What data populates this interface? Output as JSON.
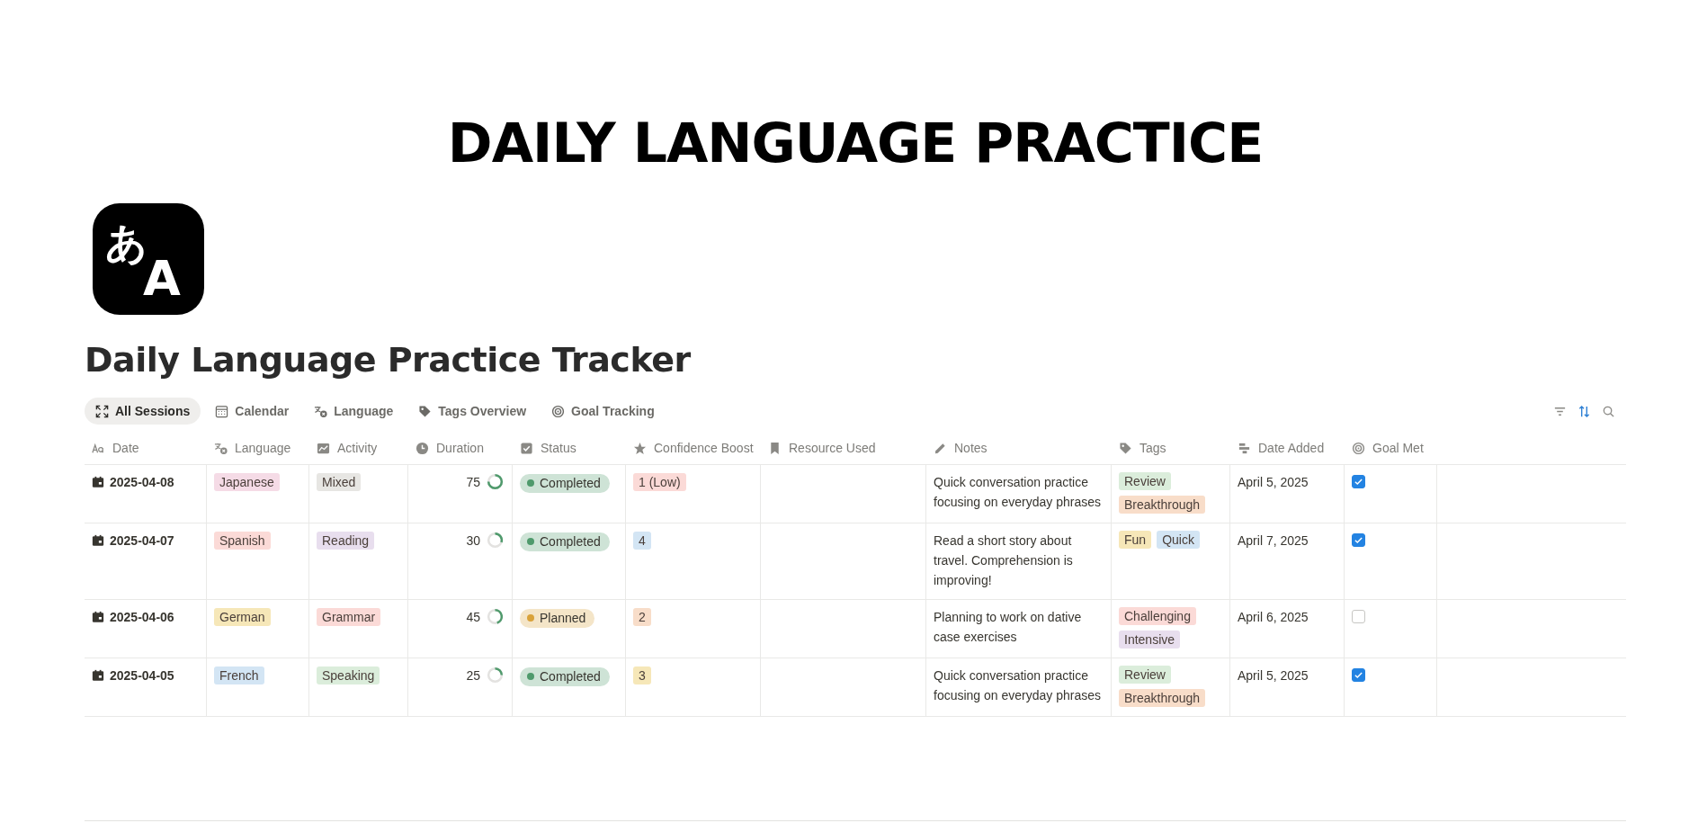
{
  "banner": {
    "title": "DAILY LANGUAGE PRACTICE"
  },
  "page_icon": {
    "glyphs": [
      "あ",
      "A"
    ]
  },
  "page_title": "Daily Language Practice Tracker",
  "views": [
    {
      "label": "All Sessions",
      "selected": true
    },
    {
      "label": "Calendar",
      "selected": false
    },
    {
      "label": "Language",
      "selected": false
    },
    {
      "label": "Tags Overview",
      "selected": false
    },
    {
      "label": "Goal Tracking",
      "selected": false
    }
  ],
  "toolbar": [
    {
      "kind": "filter",
      "active": false
    },
    {
      "kind": "sort",
      "active": true
    },
    {
      "kind": "search",
      "active": false
    }
  ],
  "table": {
    "columns": [
      "Date",
      "Language",
      "Activity",
      "Duration",
      "Status",
      "Confidence Boost",
      "Resource Used",
      "Notes",
      "Tags",
      "Date Added",
      "Goal Met"
    ],
    "rows": [
      {
        "date": "2025-04-08",
        "language": {
          "label": "Japanese",
          "color": "#f5dbe6"
        },
        "activity": {
          "label": "Mixed",
          "color": "#e7e6e3"
        },
        "duration": "75",
        "status": {
          "label": "Completed",
          "color": "#4f9a6c"
        },
        "confidence": {
          "label": "1 (Low)",
          "color": "#fbdad7"
        },
        "notes": "Quick conversation practice focusing on everyday phrases",
        "tags": [
          {
            "label": "Review",
            "color": "#dbeddb"
          },
          {
            "label": "Breakthrough",
            "color": "#f8ddc9"
          }
        ],
        "date_added": "April 5, 2025",
        "goal_met": true
      },
      {
        "date": "2025-04-07",
        "language": {
          "label": "Spanish",
          "color": "#fbdad7"
        },
        "activity": {
          "label": "Reading",
          "color": "#e8deee"
        },
        "duration": "30",
        "status": {
          "label": "Completed",
          "color": "#4f9a6c"
        },
        "confidence": {
          "label": "4",
          "color": "#d3e5f4"
        },
        "notes": "Read a short story about travel. Comprehension is improving!",
        "tags": [
          {
            "label": "Fun",
            "color": "#f6e7b8"
          },
          {
            "label": "Quick",
            "color": "#d3e5f4"
          }
        ],
        "date_added": "April 7, 2025",
        "goal_met": true
      },
      {
        "date": "2025-04-06",
        "language": {
          "label": "German",
          "color": "#f6e7b8"
        },
        "activity": {
          "label": "Grammar",
          "color": "#fbdad7"
        },
        "duration": "45",
        "status": {
          "label": "Planned",
          "color": "#d9a23a"
        },
        "confidence": {
          "label": "2",
          "color": "#f8ddc9"
        },
        "notes": "Planning to work on dative case exercises",
        "tags": [
          {
            "label": "Challenging",
            "color": "#fbdad7"
          },
          {
            "label": "Intensive",
            "color": "#e8deee"
          }
        ],
        "date_added": "April 6, 2025",
        "goal_met": false
      },
      {
        "date": "2025-04-05",
        "language": {
          "label": "French",
          "color": "#d3e5f4"
        },
        "activity": {
          "label": "Speaking",
          "color": "#dbeddb"
        },
        "duration": "25",
        "status": {
          "label": "Completed",
          "color": "#4f9a6c"
        },
        "confidence": {
          "label": "3",
          "color": "#f6e7b8"
        },
        "notes": "Quick conversation practice focusing on everyday phrases",
        "tags": [
          {
            "label": "Review",
            "color": "#dbeddb"
          },
          {
            "label": "Breakthrough",
            "color": "#f8ddc9"
          }
        ],
        "date_added": "April 5, 2025",
        "goal_met": true
      }
    ]
  }
}
